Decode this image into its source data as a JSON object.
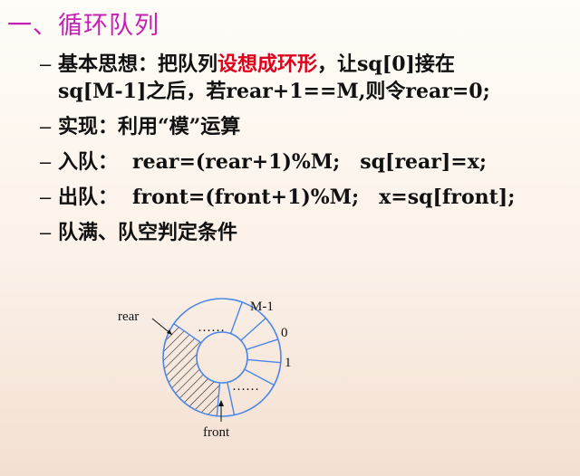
{
  "title": "一、循环队列",
  "bullets": [
    {
      "dash": "–",
      "a": "基本思想：把队列",
      "highlight": "设想成环形",
      "b": "，让sq[0]接在",
      "line2": "sq[M-1]之后，若rear+1==M,则令rear=0;"
    },
    {
      "dash": "–",
      "text": "实现：利用“模”运算"
    },
    {
      "dash": "–",
      "label": "入队：",
      "code1": "rear=(rear+1)%M;",
      "code2": "sq[rear]=x;"
    },
    {
      "dash": "–",
      "label": "出队：",
      "code1": "front=(front+1)%M;",
      "code2": "x=sq[front];"
    },
    {
      "dash": "–",
      "text": "队满、队空判定条件"
    }
  ],
  "diagram": {
    "labels": {
      "rear": "rear",
      "front": "front",
      "m1": "M-1",
      "zero": "0",
      "one": "1",
      "dots_top": "……",
      "dots_bottom": "……"
    },
    "ring_color": "#4a86e8"
  }
}
